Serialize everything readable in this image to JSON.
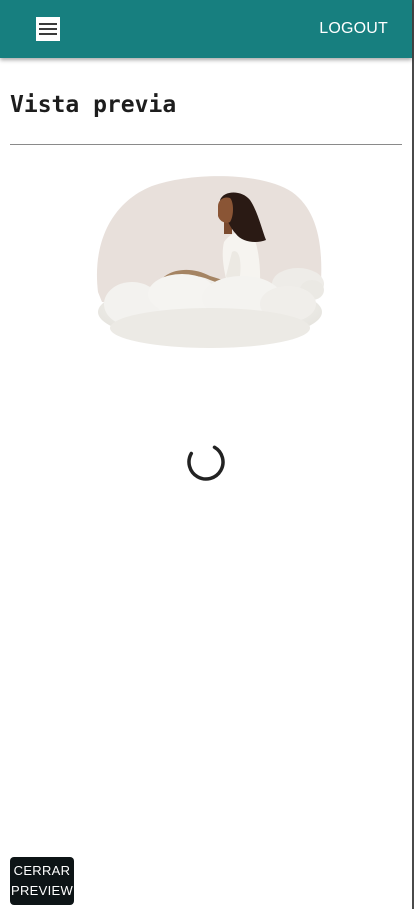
{
  "header": {
    "menu_icon": "hamburger-menu-icon",
    "logout_label": "LOGOUT",
    "background_color": "#177f7f"
  },
  "main": {
    "title": "Vista previa",
    "illustration": "woman-sitting-on-cloud",
    "loading": true
  },
  "footer": {
    "close_button_line1": "CERRAR",
    "close_button_line2": "PREVIEW"
  }
}
